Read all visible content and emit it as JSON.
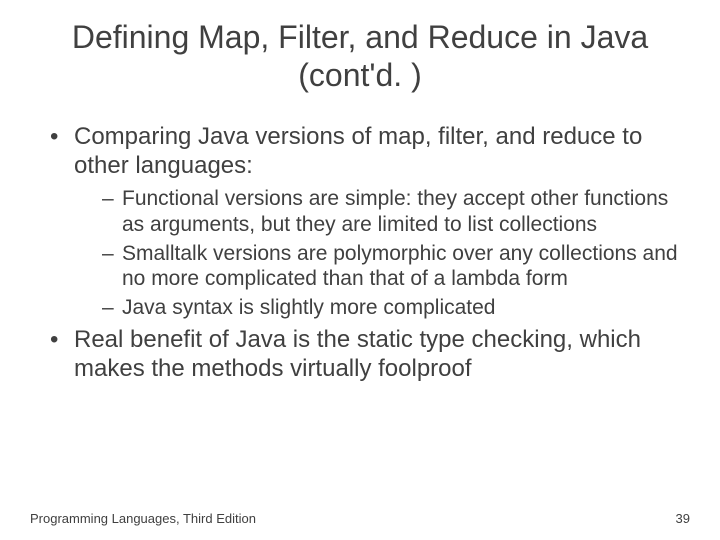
{
  "title": "Defining Map, Filter, and Reduce in Java (cont'd. )",
  "bullets": [
    {
      "text": "Comparing Java versions of map, filter, and reduce to other languages:",
      "sub": [
        "Functional versions are simple: they accept other functions as arguments, but they are limited to list collections",
        "Smalltalk versions are polymorphic over any collections and no more complicated than that of a lambda form",
        "Java syntax is slightly more complicated"
      ]
    },
    {
      "text": "Real benefit of Java is the static type checking, which makes the methods virtually foolproof",
      "sub": []
    }
  ],
  "footer": {
    "left": "Programming Languages, Third Edition",
    "right": "39"
  }
}
